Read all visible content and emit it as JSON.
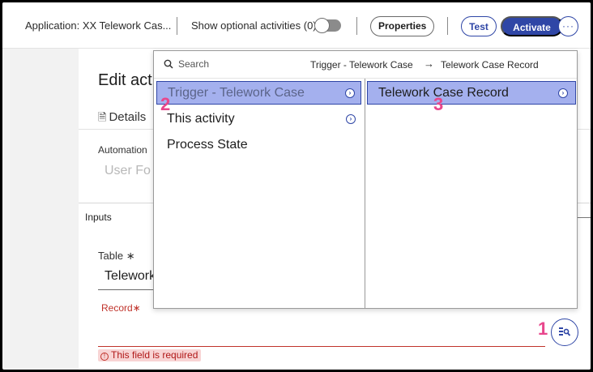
{
  "header": {
    "app_title": "Application: XX Telework Cas...",
    "optional_label": "Show optional activities (0)",
    "toggle_on": false,
    "properties_label": "Properties",
    "test_label": "Test",
    "activate_label": "Activate",
    "more_label": "···"
  },
  "card": {
    "title": "Edit act",
    "details_tab": "Details",
    "automation_label": "Automation",
    "automation_placeholder": "User Fo",
    "inputs_label": "Inputs",
    "table_label": "Table ∗",
    "table_value": "Telework",
    "record_label": "Record∗",
    "error_text": "This field is required"
  },
  "popover": {
    "search_placeholder": "Search",
    "breadcrumb": [
      "Trigger - Telework Case",
      "Telework Case Record"
    ],
    "breadcrumb_separator": "→",
    "left_items": [
      {
        "label": "Trigger - Telework Case",
        "has_children": true,
        "selected": true
      },
      {
        "label": "This activity",
        "has_children": true,
        "selected": false
      },
      {
        "label": "Process State",
        "has_children": false,
        "selected": false
      }
    ],
    "right_items": [
      {
        "label": "Telework Case Record",
        "has_children": true,
        "selected": true
      }
    ]
  },
  "annotations": [
    "1",
    "2",
    "3"
  ],
  "colors": {
    "accent": "#2f46a6",
    "selection": "#a4b0ee",
    "error": "#c0332b",
    "annotation": "#e8468c"
  }
}
